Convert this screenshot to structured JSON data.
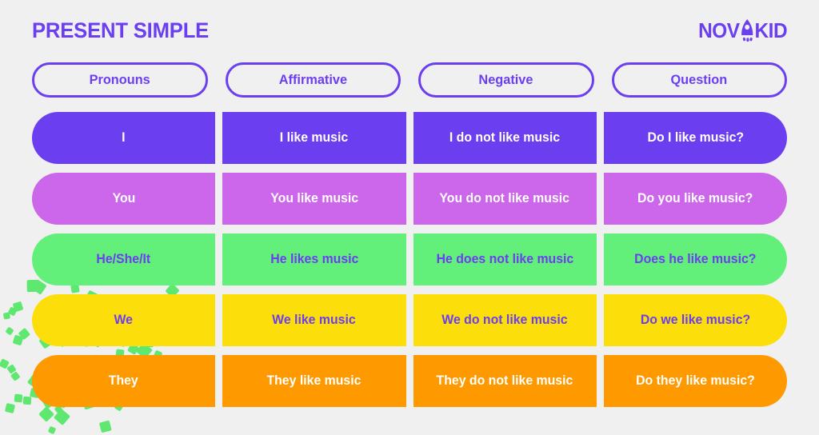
{
  "header": {
    "title": "PRESENT SIMPLE",
    "logo": {
      "text_before": "NOV",
      "rocket_letter": "A",
      "text_after": "KID"
    }
  },
  "colors": {
    "background": "#f0f0f0",
    "brand_purple": "#6B3FF0",
    "confetti_green": "#5FE870",
    "row_purple": "#6B3FF0",
    "row_magenta": "#CC66EA",
    "row_green": "#62F07B",
    "row_yellow": "#FCDE0A",
    "row_orange": "#FF9900",
    "text_white": "#FFFFFF",
    "text_purple": "#6B3FF0"
  },
  "table": {
    "columns": [
      "Pronouns",
      "Affirmative",
      "Negative",
      "Question"
    ],
    "rows": [
      {
        "pronoun": "I",
        "affirmative": "I like music",
        "negative": "I do not like music",
        "question": "Do I like music?",
        "bg": "#6B3FF0",
        "fg": "#FFFFFF"
      },
      {
        "pronoun": "You",
        "affirmative": "You like music",
        "negative": "You do not like music",
        "question": "Do you like music?",
        "bg": "#CC66EA",
        "fg": "#FFFFFF"
      },
      {
        "pronoun": "He/She/It",
        "affirmative": "He likes music",
        "negative": "He does not like music",
        "question": "Does he like music?",
        "bg": "#62F07B",
        "fg": "#6B3FF0"
      },
      {
        "pronoun": "We",
        "affirmative": "We like music",
        "negative": "We do not like music",
        "question": "Do we like music?",
        "bg": "#FCDE0A",
        "fg": "#6B3FF0"
      },
      {
        "pronoun": "They",
        "affirmative": "They like music",
        "negative": "They do not like music",
        "question": "Do they like music?",
        "bg": "#FF9900",
        "fg": "#FFFFFF"
      }
    ]
  }
}
